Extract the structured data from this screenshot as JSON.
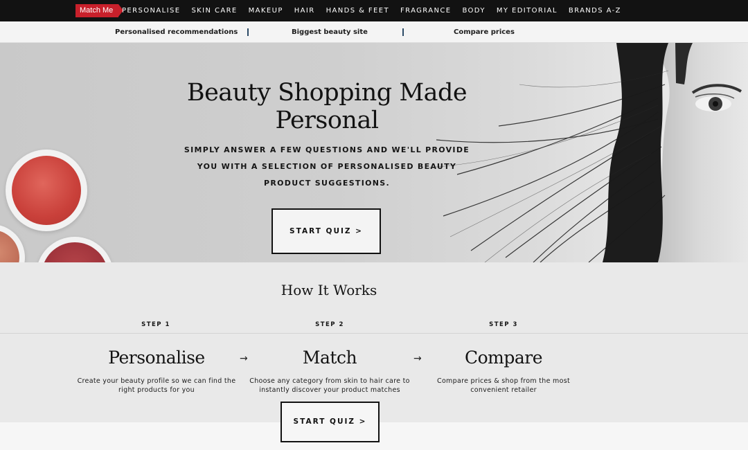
{
  "topnav": {
    "badge": "Match Me",
    "items": [
      "PERSONALISE",
      "SKIN CARE",
      "MAKEUP",
      "HAIR",
      "HANDS & FEET",
      "FRAGRANCE",
      "BODY",
      "MY EDITORIAL",
      "BRANDS A-Z"
    ]
  },
  "benefits": [
    "Personalised recommendations",
    "Biggest beauty site",
    "Compare prices"
  ],
  "hero": {
    "title": "Beauty Shopping Made Personal",
    "subtitle": "SIMPLY ANSWER A FEW QUESTIONS AND WE'LL PROVIDE YOU WITH A SELECTION OF PERSONALISED BEAUTY PRODUCT SUGGESTIONS.",
    "cta": "START QUIZ >"
  },
  "how": {
    "title": "How It Works",
    "steps": [
      {
        "label": "STEP 1",
        "name": "Personalise",
        "desc": "Create your beauty profile so we can find the right products for you"
      },
      {
        "label": "STEP 2",
        "name": "Match",
        "desc": "Choose any category from skin to hair care to instantly discover your product matches"
      },
      {
        "label": "STEP 3",
        "name": "Compare",
        "desc": "Compare prices & shop from the most convenient retailer"
      }
    ],
    "arrow": "→",
    "cta": "START QUIZ >"
  },
  "colors": {
    "nav_bg": "#121212",
    "badge": "#c8202b",
    "separator": "#2b4a66"
  }
}
